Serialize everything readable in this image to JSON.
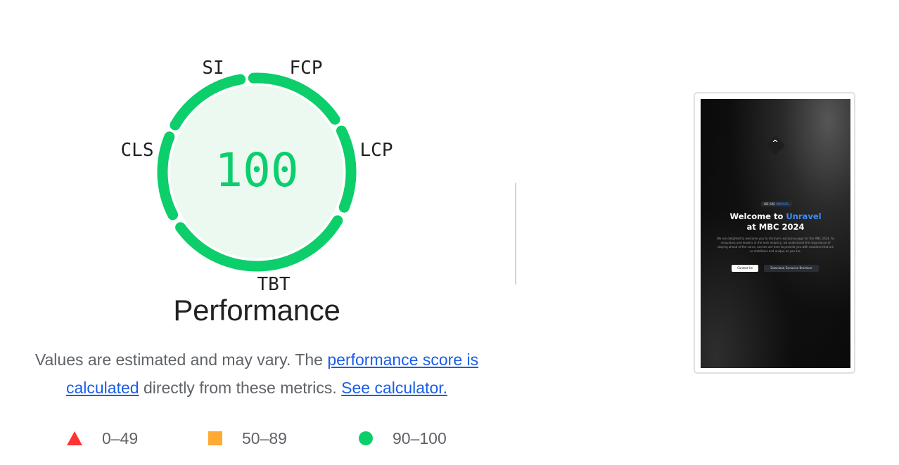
{
  "performance": {
    "score": "100",
    "score_fraction": 1.0,
    "title": "Performance",
    "metric_labels": {
      "si": "SI",
      "fcp": "FCP",
      "lcp": "LCP",
      "tbt": "TBT",
      "cls": "CLS"
    },
    "colors": {
      "pass": "#0cce6b",
      "pass_fill": "#ebf9f0",
      "average": "#ffaa33",
      "fail": "#ff3333",
      "link": "#1a5ee6"
    }
  },
  "description": {
    "text_1": "Values are estimated and may vary. The ",
    "link_1": "performance score is calculated",
    "text_2": " directly from these metrics. ",
    "link_2": "See calculator."
  },
  "legend": [
    {
      "shape": "triangle-icon",
      "range": "0–49"
    },
    {
      "shape": "square-icon",
      "range": "50–89"
    },
    {
      "shape": "circle-icon",
      "range": "90–100"
    }
  ],
  "screenshot": {
    "badge_prefix": "WE ARE",
    "badge_highlight": "UNRAVEL",
    "heading_line1_prefix": "Welcome to ",
    "heading_line1_highlight": "Unravel",
    "heading_line2": "at MBC 2024",
    "body": "We are delighted to welcome you to Unravel's exclusive page for the MBC 2024. As innovators and leaders in the tech industry, we understand the importance of staying ahead of the curve, and we are here to provide you with solutions that are as ambitious and unique as you are.",
    "button_primary": "Contact Us",
    "button_secondary": "Download Exclusive Brochure"
  }
}
